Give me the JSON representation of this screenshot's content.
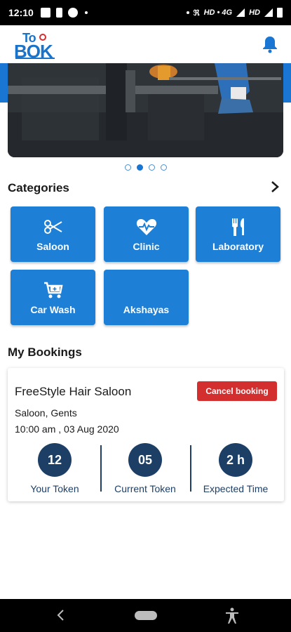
{
  "status_bar": {
    "time": "12:10",
    "network_text": "HD • 4G",
    "network_text2": "HD",
    "icons": [
      "image-icon",
      "battery-saver-icon",
      "no-disturb-icon",
      "wifi-calling-icon",
      "signal-icon",
      "battery-icon"
    ]
  },
  "app_bar": {
    "logo_top": "To",
    "logo_bottom": "BOK",
    "notification_icon": "bell-icon"
  },
  "banner": {
    "slide_count": 4,
    "active_slide": 2
  },
  "categories": {
    "title": "Categories",
    "items": [
      {
        "label": "Saloon",
        "icon": "scissors-icon"
      },
      {
        "label": "Clinic",
        "icon": "heart-pulse-icon"
      },
      {
        "label": "Laboratory",
        "icon": "fork-knife-icon"
      },
      {
        "label": "Car Wash",
        "icon": "cart-icon"
      },
      {
        "label": "Akshayas",
        "icon": "blank-icon"
      }
    ]
  },
  "bookings": {
    "title": "My Bookings",
    "card": {
      "salon_name": "FreeStyle Hair Saloon",
      "cancel_label": "Cancel booking",
      "salon_type": "Saloon, Gents",
      "datetime": "10:00 am , 03 Aug 2020",
      "stats": [
        {
          "value": "12",
          "label": "Your Token"
        },
        {
          "value": "05",
          "label": "Current Token"
        },
        {
          "value": "2 h",
          "label": "Expected Time"
        }
      ]
    }
  },
  "colors": {
    "primary": "#1e7fd6",
    "navy": "#1d3f66",
    "danger": "#d32f2f"
  }
}
